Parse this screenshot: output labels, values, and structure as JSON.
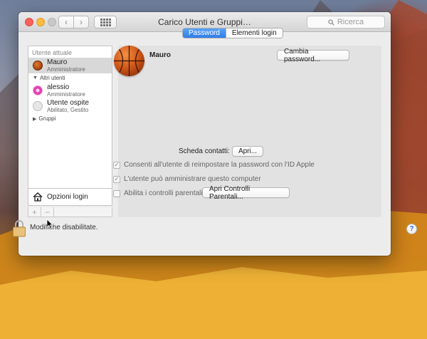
{
  "window": {
    "title": "Carico Utenti e Gruppi…",
    "search_placeholder": "Ricerca"
  },
  "sidebar": {
    "current_user_header": "Utente attuale",
    "current_user": {
      "name": "Mauro",
      "role": "Amministratore"
    },
    "other_users_header": "Altri utenti",
    "other_users": [
      {
        "name": "alessio",
        "role": "Amministratore"
      },
      {
        "name": "Utente ospite",
        "role": "Abilitato, Gestito"
      }
    ],
    "groups_label": "Gruppi",
    "login_options_label": "Opzioni login",
    "add_symbol": "+",
    "remove_symbol": "−"
  },
  "tabs": [
    {
      "label": "Password",
      "active": true
    },
    {
      "label": "Elementi login",
      "active": false
    }
  ],
  "main": {
    "user_name": "Mauro",
    "change_password_label": "Cambia password...",
    "contact_card_label": "Scheda contatti:",
    "open_button_label": "Apri...",
    "checkboxes": [
      {
        "label": "Consenti all'utente di reimpostare la password con l'ID Apple",
        "checked": true
      },
      {
        "label": "L'utente può amministrare questo computer",
        "checked": true
      },
      {
        "label": "Abilita i controlli parentali",
        "checked": false
      }
    ],
    "parental_button_label": "Apri Controlli Parentali..."
  },
  "footer": {
    "lock_text": "Modifiche disabilitate.",
    "help_symbol": "?"
  },
  "colors": {
    "accent": "#2f7de8",
    "close": "#fc605c",
    "minimize": "#fdbc40"
  }
}
